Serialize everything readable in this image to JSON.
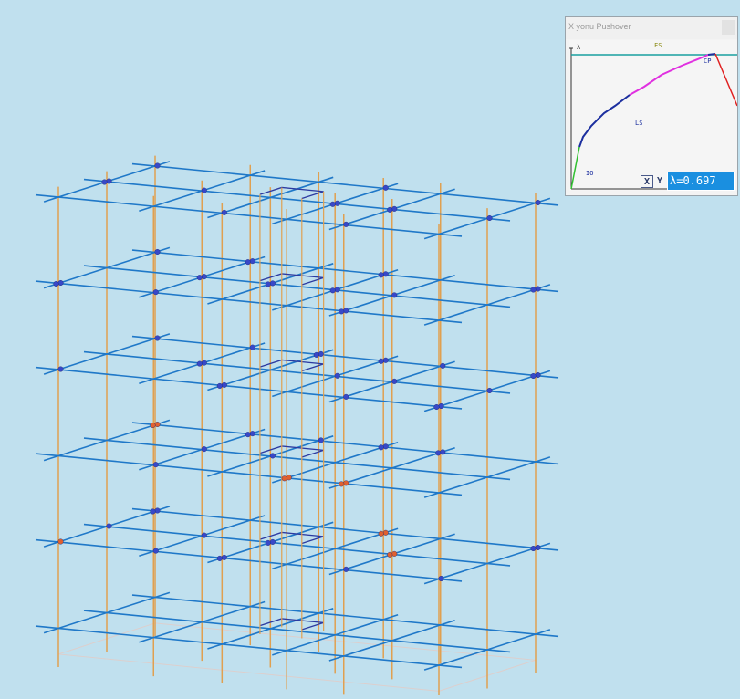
{
  "window": {
    "title": "X yonu Pushover"
  },
  "curve": {
    "y_axis_label": "λ",
    "labels": {
      "io": "IO",
      "ls": "LS",
      "cp": "CP",
      "fs": "FS"
    },
    "x_button": "X",
    "y_button": "Y",
    "lambda_readout": "λ=0.697"
  },
  "colors": {
    "background": "#c0e0ee",
    "beam": "#1f78c8",
    "column": "#e0a050",
    "hinge": "#3848c8",
    "hinge_yielded": "#e06030",
    "io_segment": "#30c030",
    "ls_segment": "#1c2f9f",
    "cp_segment": "#e030e0",
    "collapse_segment": "#e02020",
    "fs_line": "#1aa0a0",
    "readout_background": "#1a8fe0"
  }
}
